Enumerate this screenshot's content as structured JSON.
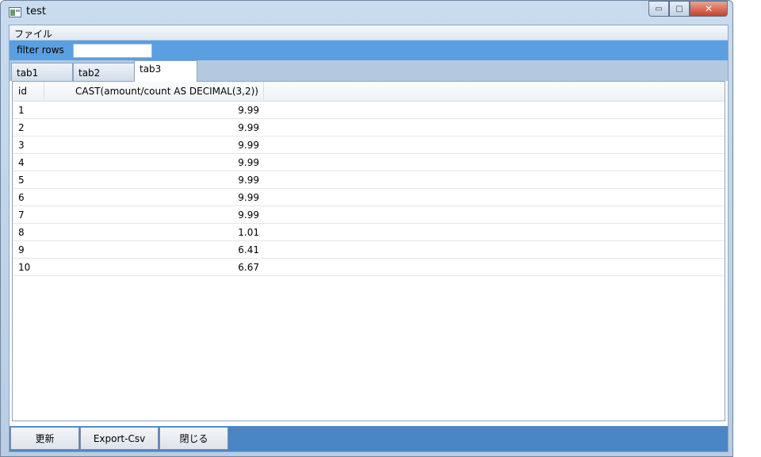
{
  "window": {
    "title": "test",
    "minimize_glyph": "▭",
    "maximize_glyph": "□",
    "close_glyph": "✕"
  },
  "menu": {
    "file": "ファイル"
  },
  "filter": {
    "label": "filter rows",
    "value": "",
    "placeholder": ""
  },
  "tabs": [
    {
      "label": "tab1",
      "selected": false
    },
    {
      "label": "tab2",
      "selected": false
    },
    {
      "label": "tab3",
      "selected": true
    }
  ],
  "grid": {
    "columns": [
      "id",
      "CAST(amount/count AS DECIMAL(3,2))"
    ],
    "rows": [
      {
        "id": "1",
        "value": "9.99"
      },
      {
        "id": "2",
        "value": "9.99"
      },
      {
        "id": "3",
        "value": "9.99"
      },
      {
        "id": "4",
        "value": "9.99"
      },
      {
        "id": "5",
        "value": "9.99"
      },
      {
        "id": "6",
        "value": "9.99"
      },
      {
        "id": "7",
        "value": "9.99"
      },
      {
        "id": "8",
        "value": "1.01"
      },
      {
        "id": "9",
        "value": "6.41"
      },
      {
        "id": "10",
        "value": "6.67"
      }
    ]
  },
  "actions": {
    "refresh": "更新",
    "export": "Export-Csv",
    "close": "閉じる"
  },
  "colors": {
    "filter_bar": "#5a9fe0",
    "button_bar": "#4a86c5",
    "tab_strip": "#b4c9df"
  }
}
